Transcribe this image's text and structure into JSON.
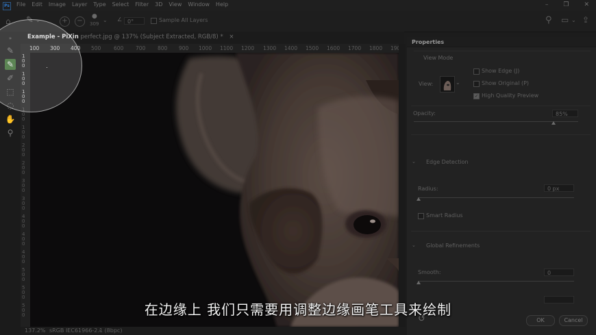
{
  "menu": {
    "logo": "Ps",
    "items": [
      "File",
      "Edit",
      "Image",
      "Layer",
      "Type",
      "Select",
      "Filter",
      "3D",
      "View",
      "Window",
      "Help"
    ]
  },
  "options": {
    "brush_size": "309",
    "angle": "0°",
    "sample_all_layers": "Sample All Layers"
  },
  "document": {
    "tab_name": "Example - PiXin",
    "tab_rest": " perfect.jpg @ 137% (Subject Extracted, RGB/8) *",
    "close": "×"
  },
  "ruler": {
    "h_ticks": [
      "100",
      "300",
      "400",
      "500",
      "600",
      "700",
      "800",
      "900",
      "1000",
      "1100",
      "1200",
      "1300",
      "1400",
      "1500",
      "1600",
      "1700",
      "1800",
      "1900"
    ],
    "v_ticks": [
      "100",
      "100",
      "100",
      "100",
      "100",
      "200",
      "200",
      "300",
      "300",
      "400",
      "400",
      "400",
      "500",
      "500",
      "500"
    ]
  },
  "status": {
    "zoom": "137.2%",
    "profile": "sRGB IEC61966-2.1 (8bpc)"
  },
  "properties": {
    "title": "Properties",
    "view_mode": {
      "label": "View Mode",
      "view_label": "View:",
      "show_edge": "Show Edge (J)",
      "show_original": "Show Original (P)",
      "high_quality": "High Quality Preview"
    },
    "opacity": {
      "label": "Opacity:",
      "value": "85%",
      "level": 0.85
    },
    "edge_detection": {
      "title": "Edge Detection",
      "radius_label": "Radius:",
      "radius_value": "0 px",
      "smart_radius": "Smart Radius"
    },
    "global_refinements": {
      "title": "Global Refinements",
      "smooth_label": "Smooth:",
      "smooth_value": "0"
    },
    "ok": "OK",
    "cancel": "Cancel"
  },
  "subtitle": "在边缘上 我们只需要用调整边缘画笔工具来绘制"
}
